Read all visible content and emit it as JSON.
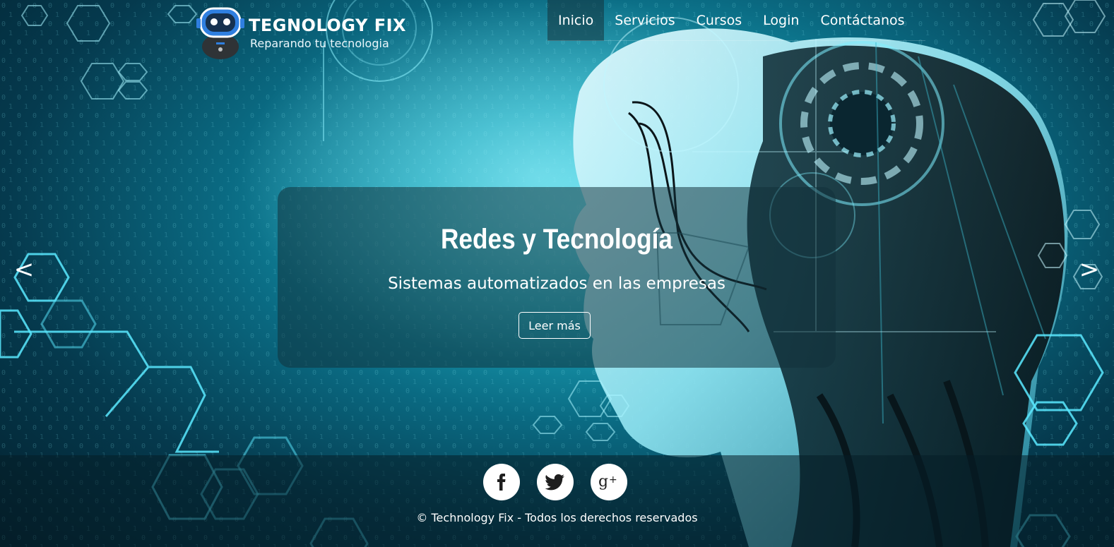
{
  "header": {
    "logo_title": "TEGNOLOGY FIX",
    "logo_subtitle": "Reparando tu tecnologia"
  },
  "nav": {
    "items": [
      {
        "label": "Inicio",
        "active": true
      },
      {
        "label": "Servicios",
        "active": false
      },
      {
        "label": "Cursos",
        "active": false
      },
      {
        "label": "Login",
        "active": false
      },
      {
        "label": "Contáctanos",
        "active": false
      }
    ]
  },
  "carousel": {
    "title": "Redes y Tecnología",
    "subtitle": "Sistemas automatizados en las empresas",
    "button_label": "Leer más",
    "prev_label": "<",
    "next_label": ">"
  },
  "footer": {
    "social": [
      {
        "name": "facebook",
        "icon": "facebook-icon"
      },
      {
        "name": "twitter",
        "icon": "twitter-icon"
      },
      {
        "name": "google-plus",
        "icon": "google-plus-icon"
      }
    ],
    "copyright": "© Technology Fix - Todos los derechos reservados"
  },
  "colors": {
    "accent": "#2cc6d8",
    "text": "#ffffff",
    "robot_blue": "#2f7fe0"
  }
}
